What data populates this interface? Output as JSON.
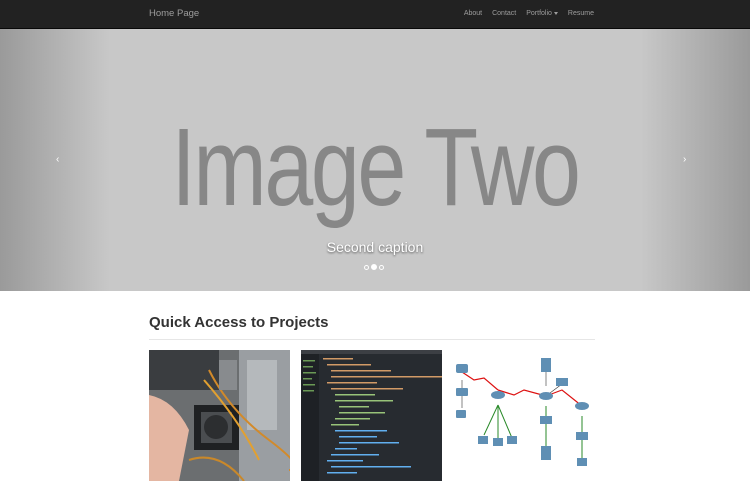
{
  "navbar": {
    "brand": "Home Page",
    "links": [
      "About",
      "Contact",
      "Portfolio",
      "Resume"
    ]
  },
  "carousel": {
    "slide_text": "Image Two",
    "caption": "Second caption",
    "prev_icon": "chevron-left-icon",
    "prev_glyph": "‹",
    "next_icon": "chevron-right-icon",
    "next_glyph": "›",
    "slide_count": 3,
    "active_slide": 2
  },
  "section": {
    "title": "Quick Access to Projects"
  },
  "colors": {
    "navbar_bg": "#222222",
    "navbar_text": "#9d9d9d",
    "carousel_bg": "#c8c8c8",
    "slide_text": "#878787"
  }
}
